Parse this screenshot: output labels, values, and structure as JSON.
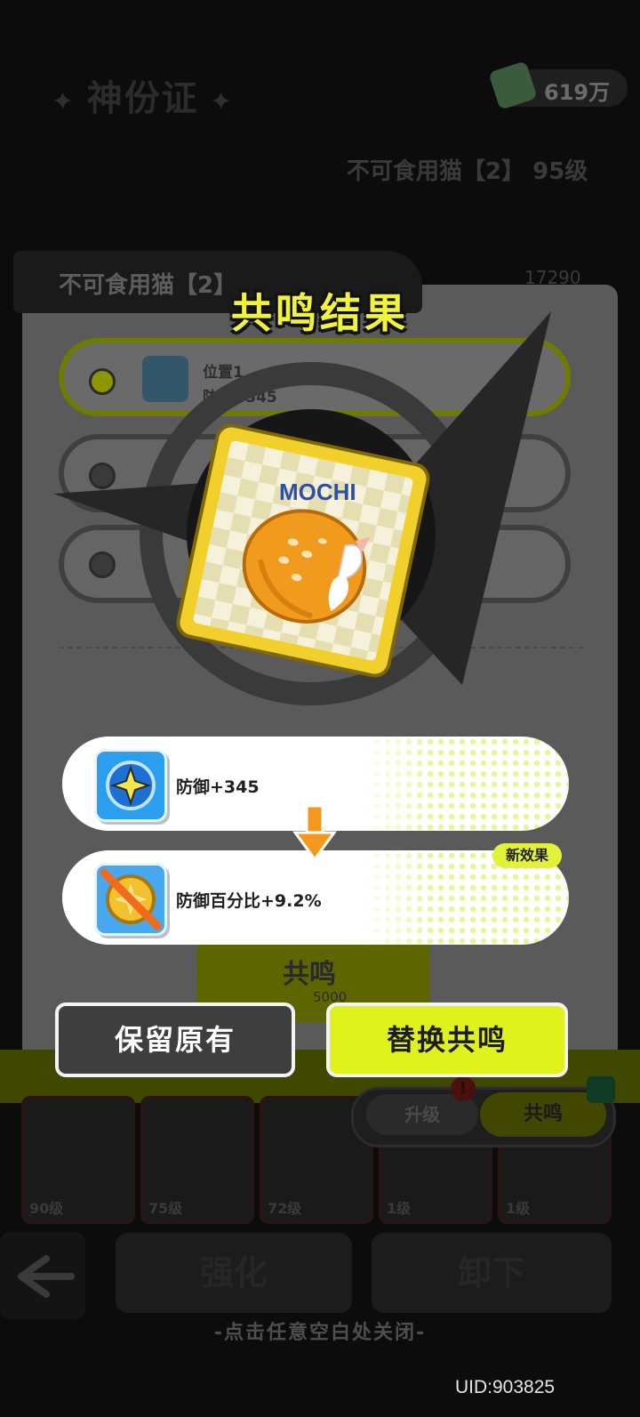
{
  "background": {
    "screen_title": "神份证",
    "currency": "619万",
    "cat_full_name": "不可食用猫【2】 95级",
    "name_tag": "不可食用猫【2】",
    "score": "17290",
    "slot1_label": "位置1",
    "slot1_effect": "防御+345",
    "resonate_label": "共鸣",
    "resonate_cost": "5000",
    "tabs": {
      "upgrade": "升级",
      "resonate": "共鸣"
    },
    "notif_mark": "!",
    "cards": [
      "90级",
      "75级",
      "72级",
      "1级",
      "1级"
    ],
    "actions": {
      "strengthen": "强化",
      "unequip": "卸下"
    }
  },
  "popup": {
    "title": "共鸣结果",
    "card_brand": "MOCHI",
    "result_old": {
      "text": "防御+345",
      "icon": "shield-star-icon"
    },
    "result_new": {
      "text": "防御百分比+9.2%",
      "icon": "broken-shield-icon",
      "badge": "新效果"
    },
    "buttons": {
      "keep": "保留原有",
      "replace": "替换共鸣"
    }
  },
  "close_hint": "-点击任意空白处关闭-",
  "uid": "UID:903825",
  "colors": {
    "accent": "#dff21c",
    "title": "#f1f43a",
    "cat": "#f09a1e"
  }
}
